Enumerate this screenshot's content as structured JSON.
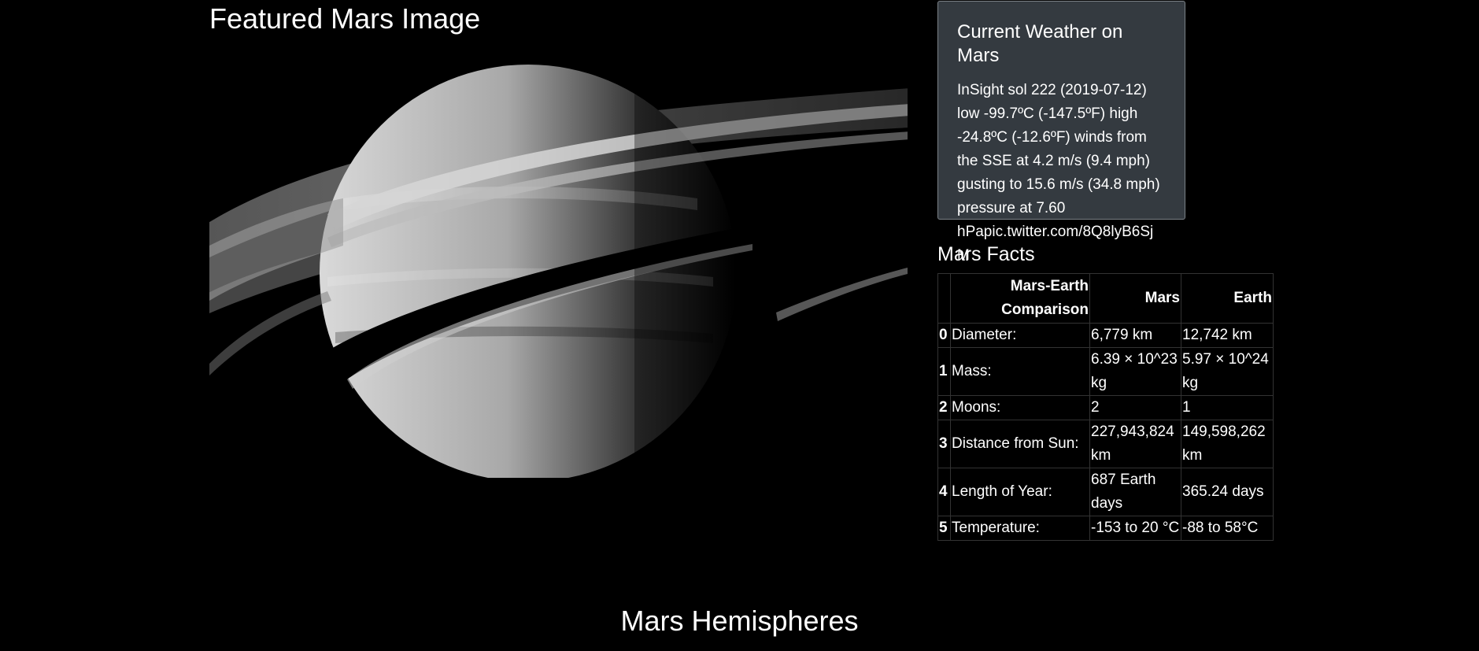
{
  "featured": {
    "title": "Featured Mars Image"
  },
  "weather": {
    "title": "Current Weather on Mars",
    "text": "InSight sol 222 (2019-07-12) low -99.7ºC (-147.5ºF) high -24.8ºC (-12.6ºF) winds from the SSE at 4.2 m/s (9.4 mph) gusting to 15.6 m/s (34.8 mph) pressure at 7.60 hPapic.twitter.com/8Q8lyB6SjM"
  },
  "facts": {
    "title": "Mars Facts",
    "headers": [
      "",
      "Mars-Earth Comparison",
      "Mars",
      "Earth"
    ],
    "rows": [
      {
        "index": "0",
        "label": "Diameter:",
        "mars": "6,779 km",
        "earth": "12,742 km"
      },
      {
        "index": "1",
        "label": "Mass:",
        "mars": "6.39 × 10^23 kg",
        "earth": "5.97 × 10^24 kg"
      },
      {
        "index": "2",
        "label": "Moons:",
        "mars": "2",
        "earth": "1"
      },
      {
        "index": "3",
        "label": "Distance from Sun:",
        "mars": "227,943,824 km",
        "earth": "149,598,262 km"
      },
      {
        "index": "4",
        "label": "Length of Year:",
        "mars": "687 Earth days",
        "earth": "365.24 days"
      },
      {
        "index": "5",
        "label": "Temperature:",
        "mars": "-153 to 20 °C",
        "earth": "-88 to 58°C"
      }
    ]
  },
  "hemispheres": {
    "title": "Mars Hemispheres"
  }
}
